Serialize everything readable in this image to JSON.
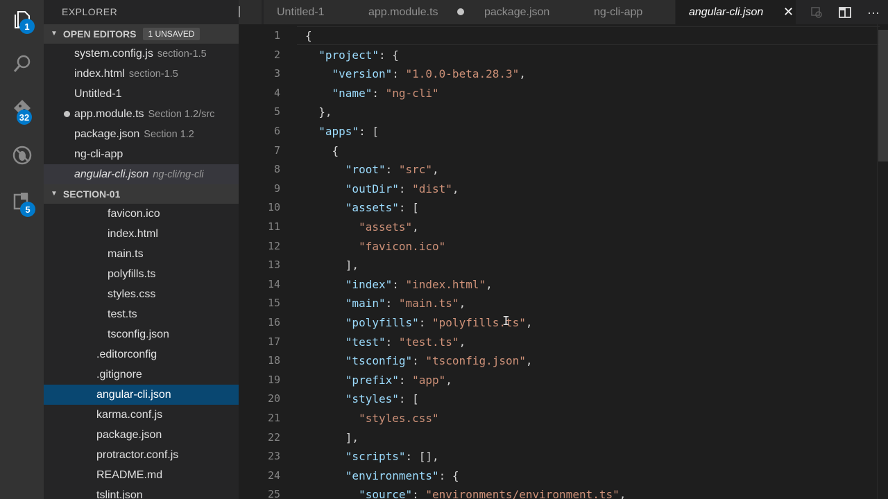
{
  "activity_bar": {
    "items": [
      {
        "icon": "files-icon",
        "badge": "1"
      },
      {
        "icon": "search-icon",
        "badge": ""
      },
      {
        "icon": "source-control-icon",
        "badge": "32"
      },
      {
        "icon": "debug-icon",
        "badge": ""
      },
      {
        "icon": "extensions-icon",
        "badge": "5"
      }
    ]
  },
  "sidebar": {
    "title": "EXPLORER",
    "open_editors": {
      "label": "OPEN EDITORS",
      "badge": "1 UNSAVED",
      "items": [
        {
          "name": "system.config.js",
          "desc": "section-1.5"
        },
        {
          "name": "index.html",
          "desc": "section-1.5"
        },
        {
          "name": "Untitled-1",
          "desc": ""
        },
        {
          "name": "app.module.ts",
          "desc": "Section 1.2/src"
        },
        {
          "name": "package.json",
          "desc": "Section 1.2"
        },
        {
          "name": "ng-cli-app",
          "desc": ""
        },
        {
          "name": "angular-cli.json",
          "desc": "ng-cli/ng-cli"
        }
      ]
    },
    "section": {
      "label": "SECTION-01",
      "items": [
        {
          "name": "favicon.ico"
        },
        {
          "name": "index.html"
        },
        {
          "name": "main.ts"
        },
        {
          "name": "polyfills.ts"
        },
        {
          "name": "styles.css"
        },
        {
          "name": "test.ts"
        },
        {
          "name": "tsconfig.json"
        },
        {
          "name": ".editorconfig"
        },
        {
          "name": ".gitignore"
        },
        {
          "name": "angular-cli.json"
        },
        {
          "name": "karma.conf.js"
        },
        {
          "name": "package.json"
        },
        {
          "name": "protractor.conf.js"
        },
        {
          "name": "README.md"
        },
        {
          "name": "tslint.json"
        }
      ]
    }
  },
  "tabs": [
    {
      "label": "Untitled-1"
    },
    {
      "label": "app.module.ts"
    },
    {
      "label": "package.json"
    },
    {
      "label": "ng-cli-app"
    },
    {
      "label": "angular-cli.json"
    }
  ],
  "toolbar": {
    "icons": [
      "open-changes-icon",
      "split-editor-icon",
      "more-actions-icon"
    ],
    "more_label": "···",
    "close_label": "✕"
  },
  "editor": {
    "lines": [
      [
        [
          "p",
          "{"
        ]
      ],
      [
        [
          "p",
          "  "
        ],
        [
          "k",
          "\"project\""
        ],
        [
          "p",
          ": {"
        ]
      ],
      [
        [
          "p",
          "    "
        ],
        [
          "k",
          "\"version\""
        ],
        [
          "p",
          ": "
        ],
        [
          "s",
          "\"1.0.0-beta.28.3\""
        ],
        [
          "p",
          ","
        ]
      ],
      [
        [
          "p",
          "    "
        ],
        [
          "k",
          "\"name\""
        ],
        [
          "p",
          ": "
        ],
        [
          "s",
          "\"ng-cli\""
        ]
      ],
      [
        [
          "p",
          "  },"
        ]
      ],
      [
        [
          "p",
          "  "
        ],
        [
          "k",
          "\"apps\""
        ],
        [
          "p",
          ": ["
        ]
      ],
      [
        [
          "p",
          "    {"
        ]
      ],
      [
        [
          "p",
          "      "
        ],
        [
          "k",
          "\"root\""
        ],
        [
          "p",
          ": "
        ],
        [
          "s",
          "\"src\""
        ],
        [
          "p",
          ","
        ]
      ],
      [
        [
          "p",
          "      "
        ],
        [
          "k",
          "\"outDir\""
        ],
        [
          "p",
          ": "
        ],
        [
          "s",
          "\"dist\""
        ],
        [
          "p",
          ","
        ]
      ],
      [
        [
          "p",
          "      "
        ],
        [
          "k",
          "\"assets\""
        ],
        [
          "p",
          ": ["
        ]
      ],
      [
        [
          "p",
          "        "
        ],
        [
          "s",
          "\"assets\""
        ],
        [
          "p",
          ","
        ]
      ],
      [
        [
          "p",
          "        "
        ],
        [
          "s",
          "\"favicon.ico\""
        ]
      ],
      [
        [
          "p",
          "      ],"
        ]
      ],
      [
        [
          "p",
          "      "
        ],
        [
          "k",
          "\"index\""
        ],
        [
          "p",
          ": "
        ],
        [
          "s",
          "\"index.html\""
        ],
        [
          "p",
          ","
        ]
      ],
      [
        [
          "p",
          "      "
        ],
        [
          "k",
          "\"main\""
        ],
        [
          "p",
          ": "
        ],
        [
          "s",
          "\"main.ts\""
        ],
        [
          "p",
          ","
        ]
      ],
      [
        [
          "p",
          "      "
        ],
        [
          "k",
          "\"polyfills\""
        ],
        [
          "p",
          ": "
        ],
        [
          "s",
          "\"polyfills.ts\""
        ],
        [
          "p",
          ","
        ]
      ],
      [
        [
          "p",
          "      "
        ],
        [
          "k",
          "\"test\""
        ],
        [
          "p",
          ": "
        ],
        [
          "s",
          "\"test.ts\""
        ],
        [
          "p",
          ","
        ]
      ],
      [
        [
          "p",
          "      "
        ],
        [
          "k",
          "\"tsconfig\""
        ],
        [
          "p",
          ": "
        ],
        [
          "s",
          "\"tsconfig.json\""
        ],
        [
          "p",
          ","
        ]
      ],
      [
        [
          "p",
          "      "
        ],
        [
          "k",
          "\"prefix\""
        ],
        [
          "p",
          ": "
        ],
        [
          "s",
          "\"app\""
        ],
        [
          "p",
          ","
        ]
      ],
      [
        [
          "p",
          "      "
        ],
        [
          "k",
          "\"styles\""
        ],
        [
          "p",
          ": ["
        ]
      ],
      [
        [
          "p",
          "        "
        ],
        [
          "s",
          "\"styles.css\""
        ]
      ],
      [
        [
          "p",
          "      ],"
        ]
      ],
      [
        [
          "p",
          "      "
        ],
        [
          "k",
          "\"scripts\""
        ],
        [
          "p",
          ": [],"
        ]
      ],
      [
        [
          "p",
          "      "
        ],
        [
          "k",
          "\"environments\""
        ],
        [
          "p",
          ": {"
        ]
      ],
      [
        [
          "p",
          "        "
        ],
        [
          "k",
          "\"source\""
        ],
        [
          "p",
          ": "
        ],
        [
          "s",
          "\"environments/environment.ts\""
        ],
        [
          "p",
          ","
        ]
      ]
    ]
  },
  "colors": {
    "accent": "#007acc",
    "selection": "#094771",
    "key": "#9cdcfe",
    "string": "#ce9178"
  }
}
